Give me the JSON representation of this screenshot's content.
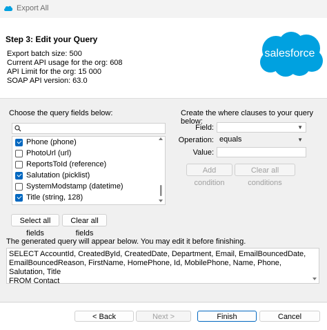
{
  "window": {
    "title": "Export All"
  },
  "header": {
    "step_title": "Step 3: Edit your Query",
    "info": [
      "Export batch size: 500",
      "Current API usage for the org: 608",
      "API Limit for the org: 15 000",
      "SOAP API version: 63.0"
    ],
    "logo_text": "salesforce"
  },
  "fields_panel": {
    "label": "Choose the query fields below:",
    "search_value": "",
    "items": [
      {
        "label": "Phone (phone)",
        "checked": true
      },
      {
        "label": "PhotoUrl (url)",
        "checked": false
      },
      {
        "label": "ReportsToId (reference)",
        "checked": false
      },
      {
        "label": "Salutation (picklist)",
        "checked": true
      },
      {
        "label": "SystemModstamp (datetime)",
        "checked": false
      },
      {
        "label": "Title (string, 128)",
        "checked": true
      }
    ],
    "select_all_label": "Select all fields",
    "clear_all_label": "Clear all fields"
  },
  "where_panel": {
    "label": "Create the where clauses to your query below:",
    "field_label": "Field:",
    "field_value": "",
    "operation_label": "Operation:",
    "operation_value": "equals",
    "value_label": "Value:",
    "value_value": "",
    "add_condition_label": "Add condition",
    "clear_conditions_label": "Clear all conditions"
  },
  "query": {
    "hint": "The generated query will appear below.  You may edit it before finishing.",
    "text": "SELECT AccountId, CreatedById, CreatedDate, Department, Email, EmailBouncedDate,\nEmailBouncedReason, FirstName, HomePhone, Id, MobilePhone, Name, Phone, Salutation, Title\nFROM Contact"
  },
  "footer": {
    "back_label": "< Back",
    "next_label": "Next >",
    "finish_label": "Finish",
    "cancel_label": "Cancel"
  },
  "colors": {
    "accent": "#0067c0",
    "logo_blue": "#00a1e0"
  }
}
